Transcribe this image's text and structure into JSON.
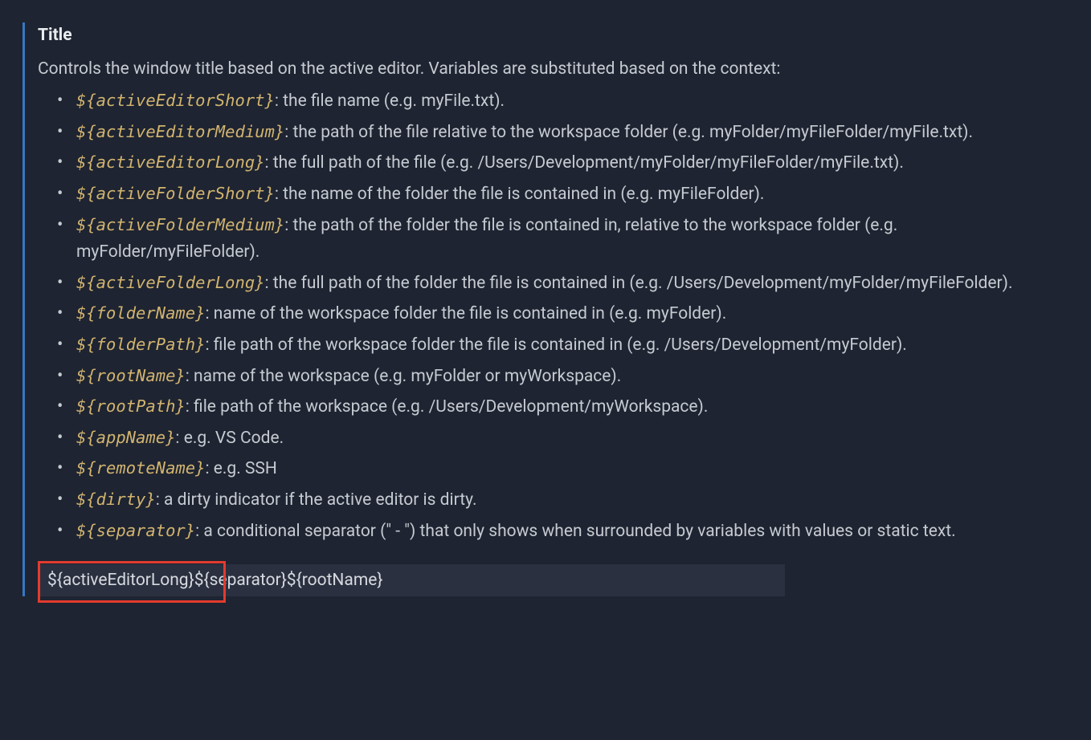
{
  "setting": {
    "title": "Title",
    "description": "Controls the window title based on the active editor. Variables are substituted based on the context:",
    "variables": [
      {
        "token": "${activeEditorShort}",
        "desc": ": the file name (e.g. myFile.txt)."
      },
      {
        "token": "${activeEditorMedium}",
        "desc": ": the path of the file relative to the workspace folder (e.g. myFolder/myFileFolder/myFile.txt)."
      },
      {
        "token": "${activeEditorLong}",
        "desc": ": the full path of the file (e.g. /Users/Development/myFolder/myFileFolder/myFile.txt)."
      },
      {
        "token": "${activeFolderShort}",
        "desc": ": the name of the folder the file is contained in (e.g. myFileFolder)."
      },
      {
        "token": "${activeFolderMedium}",
        "desc": ": the path of the folder the file is contained in, relative to the workspace folder (e.g. myFolder/myFileFolder)."
      },
      {
        "token": "${activeFolderLong}",
        "desc": ": the full path of the folder the file is contained in (e.g. /Users/Development/myFolder/myFileFolder)."
      },
      {
        "token": "${folderName}",
        "desc": ": name of the workspace folder the file is contained in (e.g. myFolder)."
      },
      {
        "token": "${folderPath}",
        "desc": ": file path of the workspace folder the file is contained in (e.g. /Users/Development/myFolder)."
      },
      {
        "token": "${rootName}",
        "desc": ": name of the workspace (e.g. myFolder or myWorkspace)."
      },
      {
        "token": "${rootPath}",
        "desc": ": file path of the workspace (e.g. /Users/Development/myWorkspace)."
      },
      {
        "token": "${appName}",
        "desc": ": e.g. VS Code."
      },
      {
        "token": "${remoteName}",
        "desc": ": e.g. SSH"
      },
      {
        "token": "${dirty}",
        "desc": ": a dirty indicator if the active editor is dirty."
      },
      {
        "token": "${separator}",
        "desc": ": a conditional separator (\" - \") that only shows when surrounded by variables with values or static text."
      }
    ],
    "input_value": "${activeEditorLong}${separator}${rootName}"
  }
}
